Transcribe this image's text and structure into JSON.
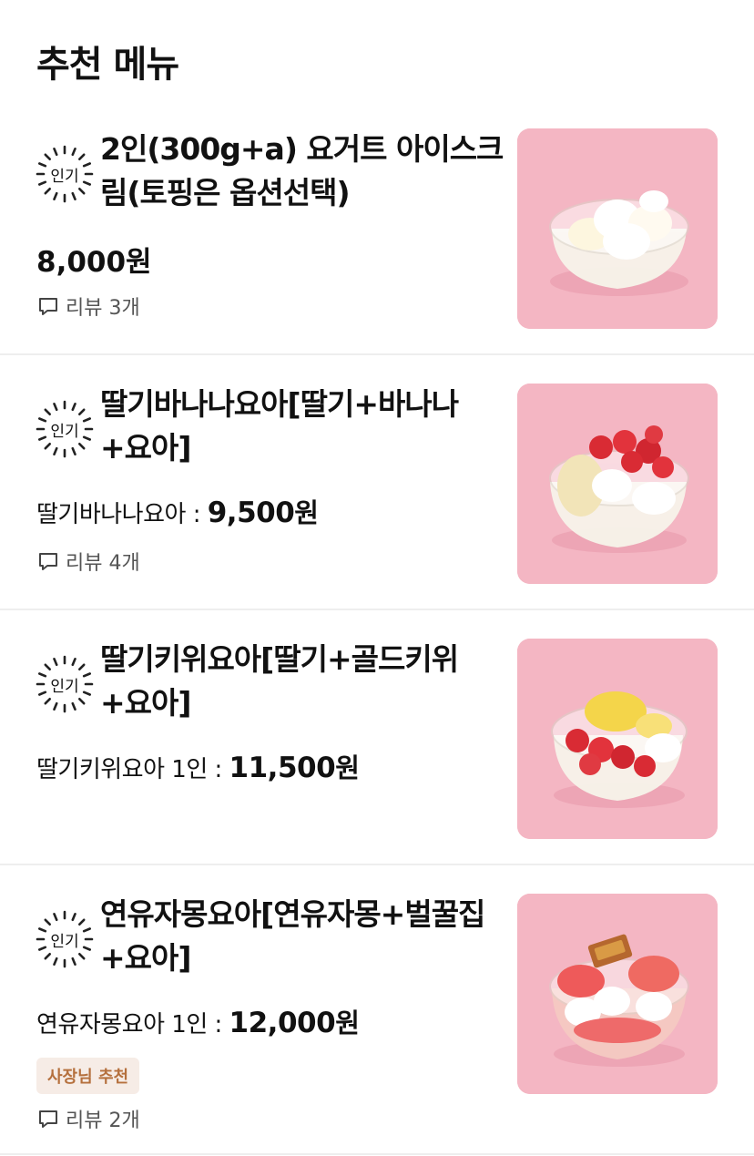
{
  "section": {
    "title": "추천 메뉴"
  },
  "badge": {
    "label": "인기"
  },
  "items": [
    {
      "name": "2인(300g+a) 요거트 아이스크림(토핑은 옵션선택)",
      "price": "8,000원",
      "review": "리뷰 3개",
      "image": "yogurt-ice-cream-cup"
    },
    {
      "name": "딸기바나나요아[딸기+바나나+요아]",
      "price_option": "딸기바나나요아 :",
      "price_amount": "9,500",
      "price_unit": "원",
      "review": "리뷰 4개",
      "image": "strawberry-banana-cup"
    },
    {
      "name": "딸기키위요아[딸기+골드키위+요아]",
      "price_option": "딸기키위요아 1인 :",
      "price_amount": "11,500",
      "price_unit": "원",
      "image": "strawberry-kiwi-cup"
    },
    {
      "name": "연유자몽요아[연유자몽+벌꿀집+요아]",
      "price_option": "연유자몽요아 1인 :",
      "price_amount": "12,000",
      "price_unit": "원",
      "tag": "사장님 추천",
      "review": "리뷰 2개",
      "image": "grapefruit-honeycomb-cup"
    }
  ],
  "colors": {
    "image_bg": "#f4b6c3",
    "tag_bg": "#f6ece6",
    "tag_text": "#b5703d",
    "divider": "#eeeeee"
  },
  "icons": {
    "badge": "popular-burst-icon",
    "review": "chat-bubble-icon"
  }
}
